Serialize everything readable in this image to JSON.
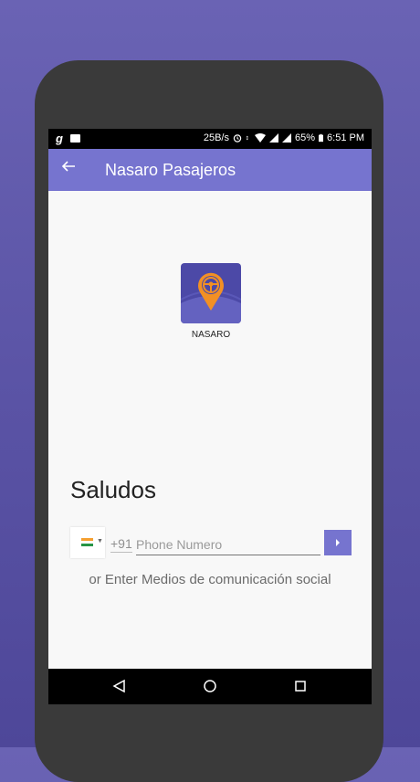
{
  "status_bar": {
    "left_icons": [
      "g-app-icon",
      "image-icon"
    ],
    "speed": "25B/s",
    "battery": "65%",
    "time": "6:51 PM",
    "right_icons": [
      "alarm-icon",
      "data-arrows-icon",
      "wifi-icon",
      "signal-icon",
      "signal-icon",
      "battery-icon"
    ]
  },
  "app_bar": {
    "back_icon": "arrow-left-icon",
    "title": "Nasaro Pasajeros",
    "color": "#7674cf"
  },
  "logo": {
    "caption": "NASARO",
    "icon": "map-pin-steering-wheel-icon",
    "pin_color": "#f29024",
    "background": "#4c49a7"
  },
  "greeting": "Saludos",
  "phone": {
    "country_flag": "india-flag-icon",
    "country_code": "+91",
    "placeholder": "Phone Numero",
    "value": ""
  },
  "submit_icon": "chevron-right-icon",
  "social_text": "or Enter Medios de comunicación social",
  "nav_bar": {
    "buttons": [
      "back-triangle-icon",
      "home-circle-icon",
      "recents-square-icon"
    ]
  }
}
